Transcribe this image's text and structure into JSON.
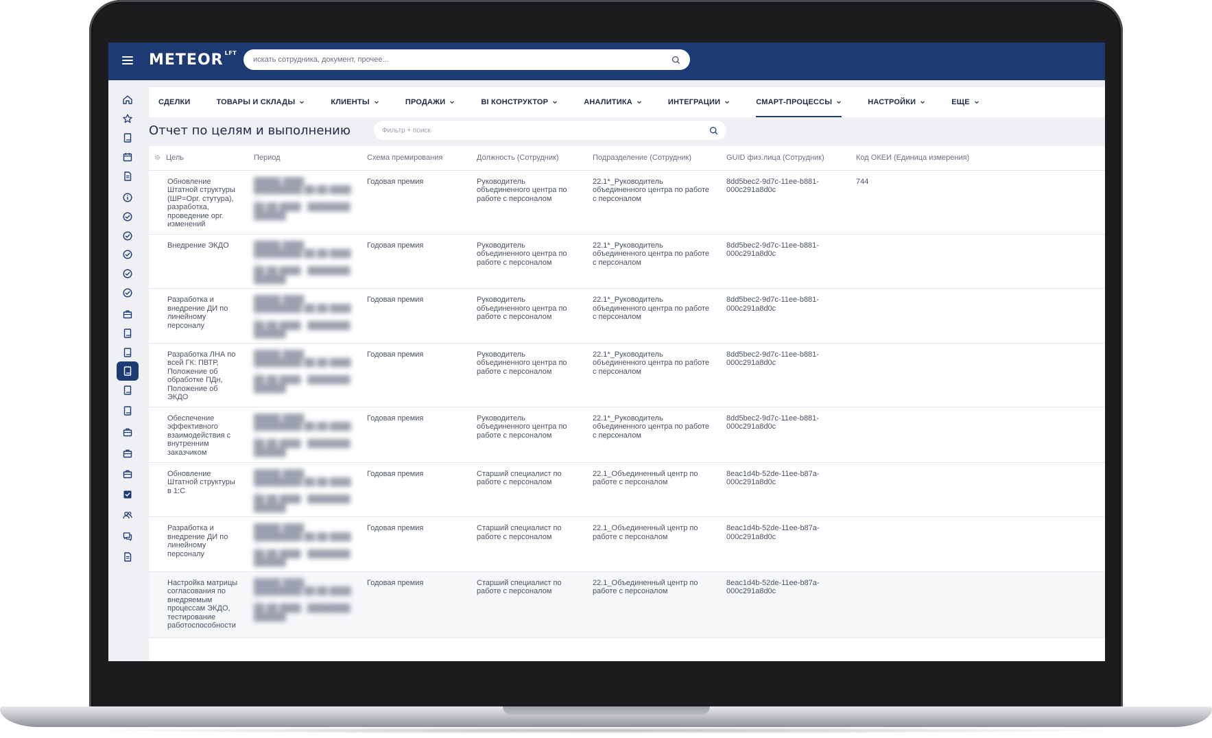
{
  "header": {
    "logo": "METEOR",
    "logo_sup": "LFT",
    "search_placeholder": "искать сотрудника, документ, прочее..."
  },
  "nav": {
    "items": [
      {
        "label": "СДЕЛКИ",
        "dropdown": false
      },
      {
        "label": "ТОВАРЫ И СКЛАДЫ",
        "dropdown": true
      },
      {
        "label": "КЛИЕНТЫ",
        "dropdown": true
      },
      {
        "label": "ПРОДАЖИ",
        "dropdown": true
      },
      {
        "label": "BI КОНСТРУКТОР",
        "dropdown": true
      },
      {
        "label": "АНАЛИТИКА",
        "dropdown": true
      },
      {
        "label": "ИНТЕГРАЦИИ",
        "dropdown": true
      },
      {
        "label": "СМАРТ-ПРОЦЕССЫ",
        "dropdown": true,
        "active": true
      },
      {
        "label": "НАСТРОЙКИ",
        "dropdown": true
      },
      {
        "label": "ЕЩЕ",
        "dropdown": true
      }
    ]
  },
  "page": {
    "title": "Отчет по целям и выполнению",
    "filter_placeholder": "Фильтр + поиск"
  },
  "sidebar": {
    "icons": [
      "home-icon",
      "star-icon",
      "book-icon",
      "calendar-icon",
      "document-icon",
      "info-icon",
      "check-circle-icon",
      "check-circle-icon",
      "check-circle-icon",
      "check-circle-icon",
      "check-circle-icon",
      "briefcase-icon",
      "book-icon",
      "book-icon",
      "book-icon",
      "book-icon",
      "book-icon",
      "briefcase-icon",
      "briefcase-icon",
      "briefcase-icon",
      "checkbox-icon",
      "users-icon",
      "chat-icon",
      "document-icon"
    ],
    "active_index": 14
  },
  "table": {
    "columns": [
      "Цель",
      "Период",
      "Схема премирования",
      "Должность (Сотрудник)",
      "Подразделение (Сотрудник)",
      "GUID физ.лица (Сотрудник)",
      "Код ОКЕИ (Единица измерения)"
    ],
    "rows": [
      {
        "goal": "Обновление Штатной структуры (ШР=Орг. стутура), разработка, проведение орг. изменений",
        "period": "",
        "scheme": "Годовая премия",
        "position": "Руководитель объединенного центра по работе с персоналом",
        "division": "22.1*_Руководитель объединенного центра по работе с персоналом",
        "guid": "8dd5bec2-9d7c-11ee-b881-000c291a8d0c",
        "okei": "744"
      },
      {
        "goal": "Внедрение ЭКДО",
        "period": "",
        "scheme": "Годовая премия",
        "position": "Руководитель объединенного центра по работе с персоналом",
        "division": "22.1*_Руководитель объединенного центра по работе с персоналом",
        "guid": "8dd5bec2-9d7c-11ee-b881-000c291a8d0c",
        "okei": ""
      },
      {
        "goal": "Разработка и внедрение ДИ по линейному персоналу",
        "period": "",
        "scheme": "Годовая премия",
        "position": "Руководитель объединенного центра по работе с персоналом",
        "division": "22.1*_Руководитель объединенного центра по работе с персоналом",
        "guid": "8dd5bec2-9d7c-11ee-b881-000c291a8d0c",
        "okei": ""
      },
      {
        "goal": "Разработка ЛНА по всей ГК: ПВТР, Положение об обработке ПДн, Положение об ЭКДО",
        "period": "",
        "scheme": "Годовая премия",
        "position": "Руководитель объединенного центра по работе с персоналом",
        "division": "22.1*_Руководитель объединенного центра по работе с персоналом",
        "guid": "8dd5bec2-9d7c-11ee-b881-000c291a8d0c",
        "okei": ""
      },
      {
        "goal": "Обеспечение эффективного взаимодействия с внутренним заказчиком",
        "period": "",
        "scheme": "Годовая премия",
        "position": "Руководитель объединенного центра по работе с персоналом",
        "division": "22.1*_Руководитель объединенного центра по работе с персоналом",
        "guid": "8dd5bec2-9d7c-11ee-b881-000c291a8d0c",
        "okei": ""
      },
      {
        "goal": "Обновление Штатной структуры в 1:С",
        "period": "",
        "scheme": "Годовая премия",
        "position": "Старший специалист по работе с персоналом",
        "division": "22.1_Объединенный центр по работе с персоналом",
        "guid": "8eac1d4b-52de-11ee-b87a-000c291a8d0c",
        "okei": ""
      },
      {
        "goal": "Разработка и внедрение ДИ по линейному персоналу",
        "period": "",
        "scheme": "Годовая премия",
        "position": "Старший специалист по работе с персоналом",
        "division": "22.1_Объединенный центр по работе с персоналом",
        "guid": "8eac1d4b-52de-11ee-b87a-000c291a8d0c",
        "okei": ""
      },
      {
        "goal": "Настройка матрицы согласования по внедряемым процессам ЭКДО, тестирование работоспособности",
        "period": "",
        "scheme": "Годовая премия",
        "position": "Старший специалист по работе с персоналом",
        "division": "22.1_Объединенный центр по работе с персоналом",
        "guid": "8eac1d4b-52de-11ee-b87a-000c291a8d0c",
        "okei": ""
      }
    ]
  }
}
